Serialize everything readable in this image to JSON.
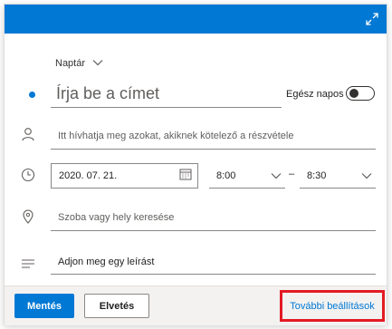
{
  "colors": {
    "accent": "#0078d4",
    "highlight": "#e31b23",
    "dot": "#0078d4"
  },
  "header": {
    "expand_icon": "expand-icon"
  },
  "calendar": {
    "label": "Naptár",
    "icon": "chevron-down-icon"
  },
  "title": {
    "placeholder": "Írja be a címet"
  },
  "all_day": {
    "label": "Egész napos",
    "enabled": false
  },
  "attendees": {
    "icon": "person-icon",
    "placeholder": "Itt hívhatja meg azokat, akiknek kötelező a részvétele"
  },
  "schedule": {
    "icon": "clock-icon",
    "date": "2020. 07. 21.",
    "date_icon": "calendar-icon",
    "start_time": "8:00",
    "separator": "–",
    "end_time": "8:30"
  },
  "location": {
    "icon": "location-pin-icon",
    "placeholder": "Szoba vagy hely keresése"
  },
  "description": {
    "icon": "text-lines-icon",
    "placeholder": "Adjon meg egy leírást"
  },
  "footer": {
    "save_label": "Mentés",
    "discard_label": "Elvetés",
    "more_options_label": "További beállítások"
  }
}
